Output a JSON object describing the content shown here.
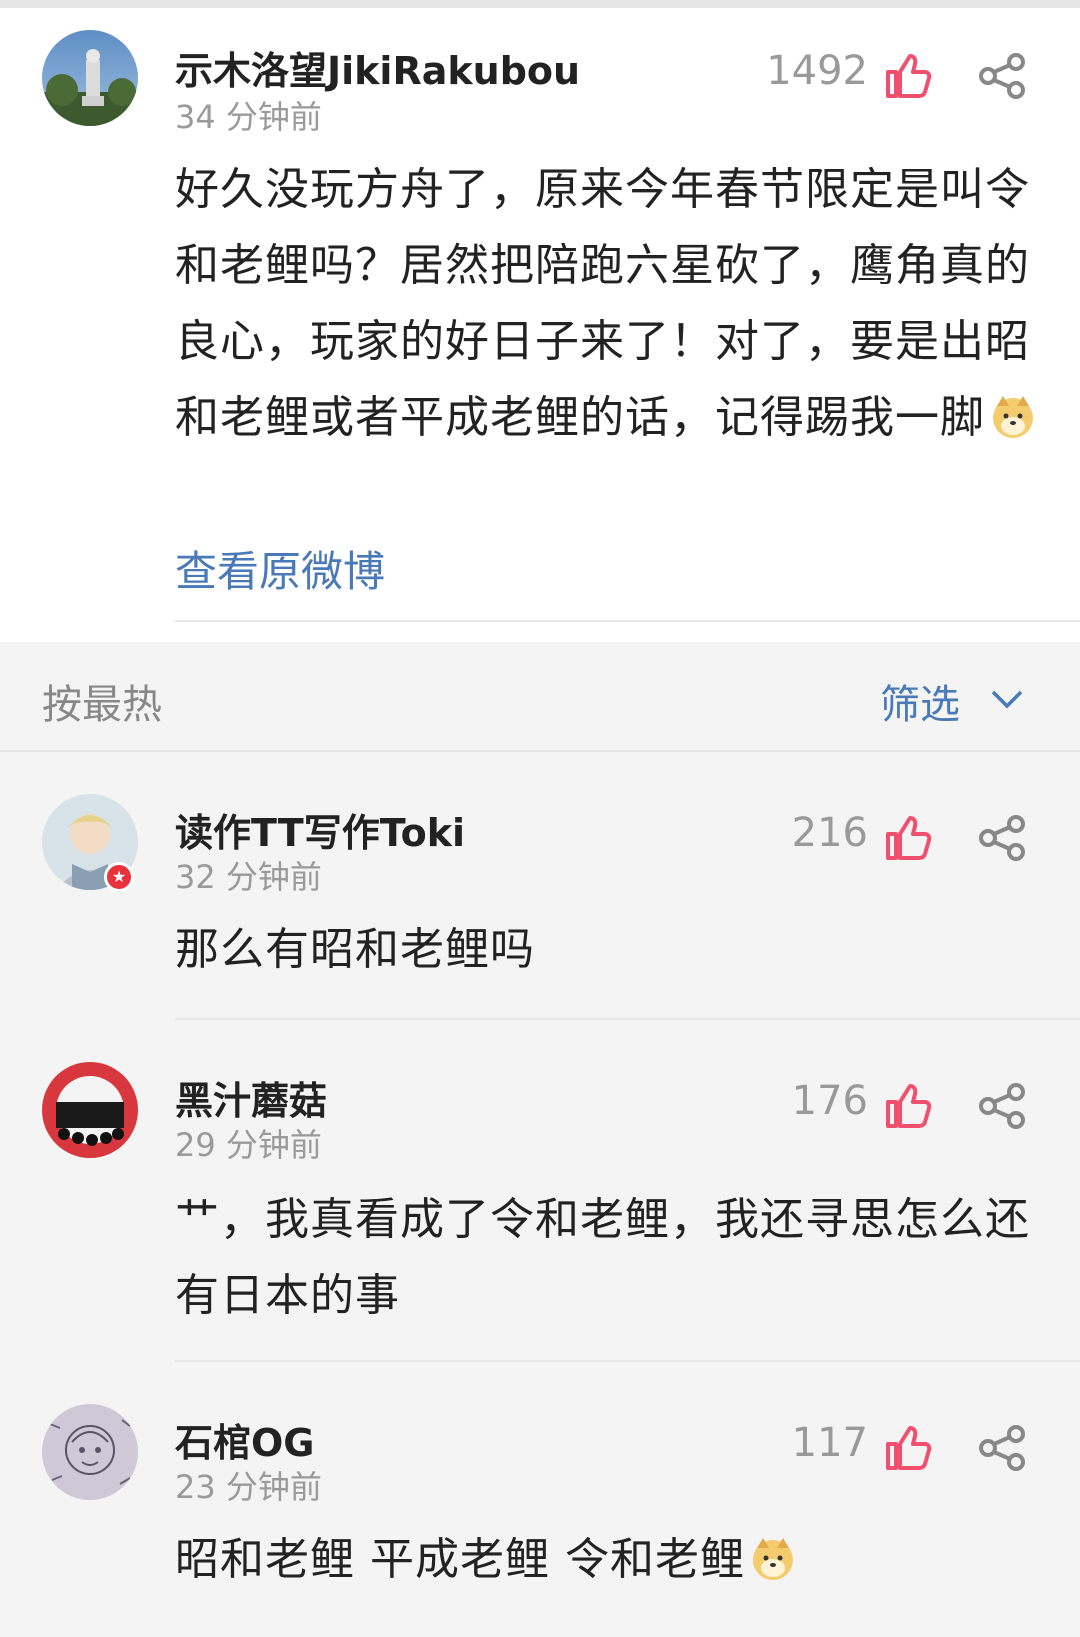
{
  "main_comment": {
    "username": "示木洛望JikiRakubou",
    "time": "34 分钟前",
    "likes": "1492",
    "content": "好久没玩方舟了，原来今年春节限定是叫令和老鲤吗？居然把陪跑六星砍了，鹰角真的良心，玩家的好日子来了！对了，要是出昭和老鲤或者平成老鲤的话，记得踢我一脚",
    "view_original": "查看原微博"
  },
  "sort_bar": {
    "sort_label": "按最热",
    "filter_label": "筛选"
  },
  "replies": [
    {
      "username": "读作TT写作Toki",
      "time": "32 分钟前",
      "likes": "216",
      "content": "那么有昭和老鲤吗"
    },
    {
      "username": "黑汁蘑菇",
      "time": "29 分钟前",
      "likes": "176",
      "content": "艹，我真看成了令和老鲤，我还寻思怎么还有日本的事"
    },
    {
      "username": "石棺OG",
      "time": "23 分钟前",
      "likes": "117",
      "content": "昭和老鲤 平成老鲤 令和老鲤"
    }
  ],
  "colors": {
    "like_accent": "#f0506e",
    "link": "#4a79b8",
    "muted": "#9a9a9a"
  },
  "icons": {
    "like": "thumbs-up-icon",
    "share": "share-icon",
    "emoji": "doge-emoji-icon"
  }
}
